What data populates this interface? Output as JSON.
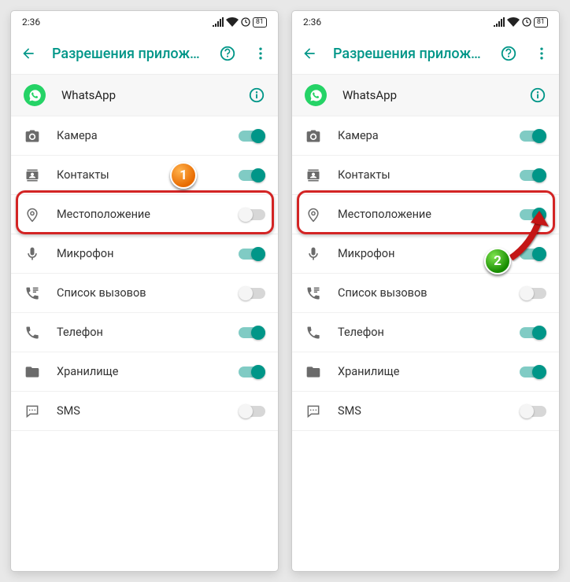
{
  "status": {
    "time": "2:36",
    "battery": "81"
  },
  "appbar": {
    "title": "Разрешения приложе…"
  },
  "app": {
    "name": "WhatsApp"
  },
  "screens": [
    {
      "permissions": [
        {
          "icon": "camera",
          "label": "Камера",
          "on": true
        },
        {
          "icon": "contacts",
          "label": "Контакты",
          "on": true
        },
        {
          "icon": "location",
          "label": "Местоположение",
          "on": false
        },
        {
          "icon": "mic",
          "label": "Микрофон",
          "on": true
        },
        {
          "icon": "calllog",
          "label": "Список вызовов",
          "on": false
        },
        {
          "icon": "phone",
          "label": "Телефон",
          "on": true
        },
        {
          "icon": "storage",
          "label": "Хранилище",
          "on": true
        },
        {
          "icon": "sms",
          "label": "SMS",
          "on": false
        }
      ]
    },
    {
      "permissions": [
        {
          "icon": "camera",
          "label": "Камера",
          "on": true
        },
        {
          "icon": "contacts",
          "label": "Контакты",
          "on": true
        },
        {
          "icon": "location",
          "label": "Местоположение",
          "on": true
        },
        {
          "icon": "mic",
          "label": "Микрофон",
          "on": true
        },
        {
          "icon": "calllog",
          "label": "Список вызовов",
          "on": false
        },
        {
          "icon": "phone",
          "label": "Телефон",
          "on": true
        },
        {
          "icon": "storage",
          "label": "Хранилище",
          "on": true
        },
        {
          "icon": "sms",
          "label": "SMS",
          "on": false
        }
      ]
    }
  ],
  "annotations": {
    "badge1": "1",
    "badge2": "2"
  }
}
